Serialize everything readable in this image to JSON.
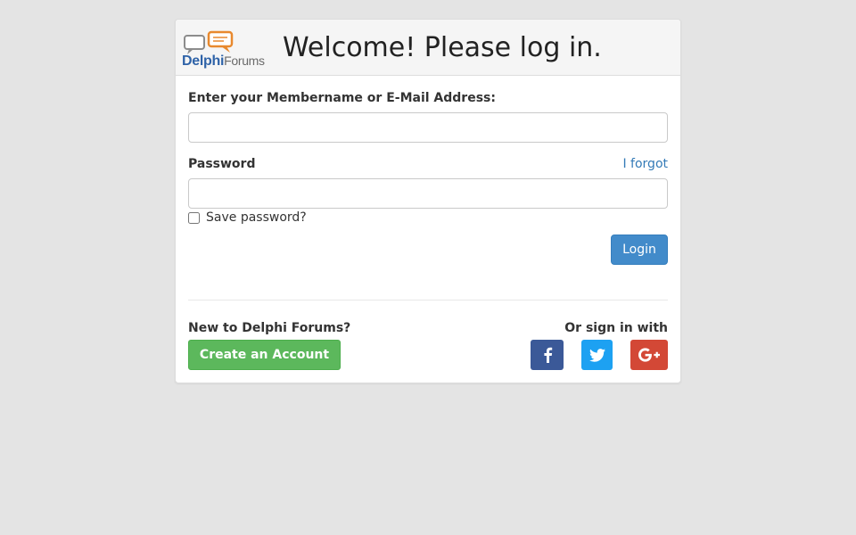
{
  "header": {
    "logo_primary": "Delphi",
    "logo_secondary": "Forums",
    "title": "Welcome! Please log in."
  },
  "form": {
    "member_label": "Enter your Membername or E-Mail Address:",
    "member_value": "",
    "password_label": "Password",
    "password_value": "",
    "forgot_link": "I forgot",
    "save_password_label": "Save password?",
    "save_password_checked": false,
    "login_button": "Login"
  },
  "footer": {
    "new_label": "New to Delphi Forums?",
    "create_button": "Create an Account",
    "signin_label": "Or sign in with",
    "social": [
      {
        "icon": "facebook-icon",
        "color": "#3b5998"
      },
      {
        "icon": "twitter-icon",
        "color": "#1da1f2"
      },
      {
        "icon": "google-plus-icon",
        "color": "#d34836"
      }
    ]
  },
  "colors": {
    "page_bg": "#e4e4e4",
    "primary": "#428bca",
    "success": "#5cb85c",
    "link": "#337ab7"
  }
}
